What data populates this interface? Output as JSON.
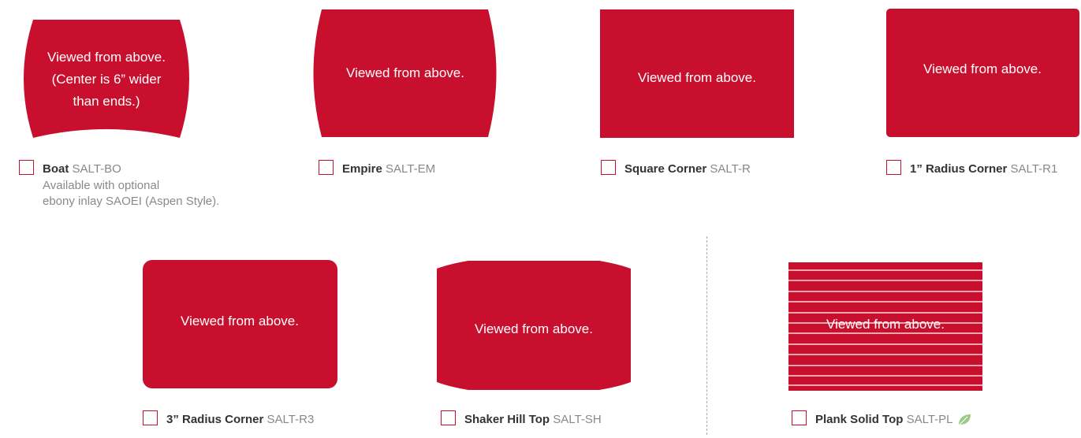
{
  "colors": {
    "shape_fill": "#c8102e",
    "label_text": "#ffffff",
    "code_text": "#888888",
    "name_text": "#333333"
  },
  "shapes": {
    "boat": {
      "caption_lines": [
        "Viewed from above.",
        "(Center is 6” wider",
        "than ends.)"
      ]
    },
    "empire": {
      "caption": "Viewed from above."
    },
    "square": {
      "caption": "Viewed from above."
    },
    "r1": {
      "caption": "Viewed from above."
    },
    "r3": {
      "caption": "Viewed from above."
    },
    "shaker": {
      "caption": "Viewed from above."
    },
    "plank": {
      "caption": "Viewed from above."
    }
  },
  "options": {
    "boat": {
      "name": "Boat",
      "code": "SALT-BO",
      "note_lines": [
        "Available with optional",
        "ebony inlay SAOEI (Aspen Style)."
      ]
    },
    "empire": {
      "name": "Empire",
      "code": "SALT-EM"
    },
    "square": {
      "name": "Square Corner",
      "code": "SALT-R"
    },
    "r1": {
      "name": "1” Radius Corner",
      "code": "SALT-R1"
    },
    "r3": {
      "name": "3” Radius Corner",
      "code": "SALT-R3"
    },
    "shaker": {
      "name": "Shaker Hill Top",
      "code": "SALT-SH"
    },
    "plank": {
      "name": "Plank Solid Top",
      "code": "SALT-PL",
      "badge_icon": "leaf-icon"
    }
  }
}
